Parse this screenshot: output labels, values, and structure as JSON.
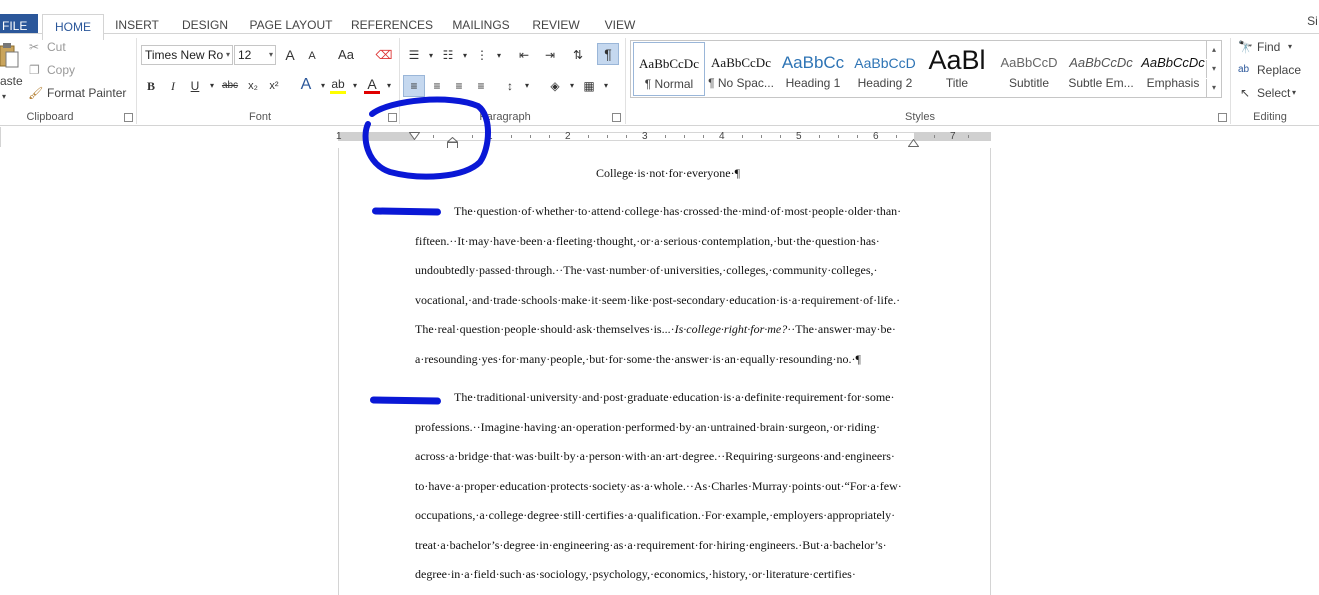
{
  "tabs": {
    "file": "FILE",
    "home": "HOME",
    "insert": "INSERT",
    "design": "DESIGN",
    "page_layout": "PAGE LAYOUT",
    "references": "REFERENCES",
    "mailings": "MAILINGS",
    "review": "REVIEW",
    "view": "VIEW",
    "signin": "Si"
  },
  "clipboard": {
    "paste": "aste",
    "cut": "Cut",
    "copy": "Copy",
    "format_painter": "Format Painter",
    "label": "Clipboard"
  },
  "font": {
    "name": "Times New Ro",
    "size": "12",
    "bold": "B",
    "italic": "I",
    "underline": "U",
    "strike": "abc",
    "subscript": "x₂",
    "superscript": "x²",
    "grow": "A",
    "shrink": "A",
    "case": "Aa",
    "label": "Font"
  },
  "paragraph": {
    "label": "Paragraph",
    "pilcrow": "¶"
  },
  "styles": {
    "label": "Styles",
    "items": [
      {
        "preview": "AaBbCcDc",
        "name": "¶ Normal"
      },
      {
        "preview": "AaBbCcDc",
        "name": "¶ No Spac..."
      },
      {
        "preview": "AaBbCc",
        "name": "Heading 1"
      },
      {
        "preview": "AaBbCcD",
        "name": "Heading 2"
      },
      {
        "preview": "AaBl",
        "name": "Title"
      },
      {
        "preview": "AaBbCcD",
        "name": "Subtitle"
      },
      {
        "preview": "AaBbCcDc",
        "name": "Subtle Em..."
      },
      {
        "preview": "AaBbCcDc",
        "name": "Emphasis"
      }
    ]
  },
  "editing": {
    "find": "Find",
    "replace": "Replace",
    "select": "Select",
    "label": "Editing"
  },
  "ruler": {
    "numbers": [
      "1",
      "1",
      "2",
      "3",
      "4",
      "5",
      "6",
      "7"
    ]
  },
  "document": {
    "title": "College·is·not·for·everyone·¶",
    "para1": [
      "The·question·of·whether·to·attend·college·has·crossed·the·mind·of·most·people·older·than·",
      "fifteen.··It·may·have·been·a·fleeting·thought,·or·a·serious·contemplation,·but·the·question·has·",
      "undoubtedly·passed·through.··The·vast·number·of·universities,·colleges,·community·colleges,·",
      "vocational,·and·trade·schools·make·it·seem·like·post-secondary·education·is·a·requirement·of·life.·",
      "The·real·question·people·should·ask·themselves·is...·",
      "Is·college·right·for·me?",
      "··The·answer·may·be·",
      "a·resounding·yes·for·many·people,·but·for·some·the·answer·is·an·equally·resounding·no.·¶"
    ],
    "para2": [
      "The·traditional·university·and·post·graduate·education·is·a·definite·requirement·for·some·",
      "professions.··Imagine·having·an·operation·performed·by·an·untrained·brain·surgeon,·or·riding·",
      "across·a·bridge·that·was·built·by·a·person·with·an·art·degree.··Requiring·surgeons·and·engineers·",
      "to·have·a·proper·education·protects·society·as·a·whole.··As·Charles·Murray·points·out·“For·a·few·",
      "occupations,·a·college·degree·still·certifies·a·qualification.·For·example,·employers·appropriately·",
      "treat·a·bachelor’s·degree·in·engineering·as·a·requirement·for·hiring·engineers.·But·a·bachelor’s·",
      "degree·in·a·field·such·as·sociology,·psychology,·economics,·history,·or·literature·certifies·"
    ]
  },
  "colors": {
    "file_tab": "#2b579a",
    "annotation_ink": "#0a18d6",
    "font_color_bar": "#e00000",
    "highlight_bar": "#ffff00"
  }
}
